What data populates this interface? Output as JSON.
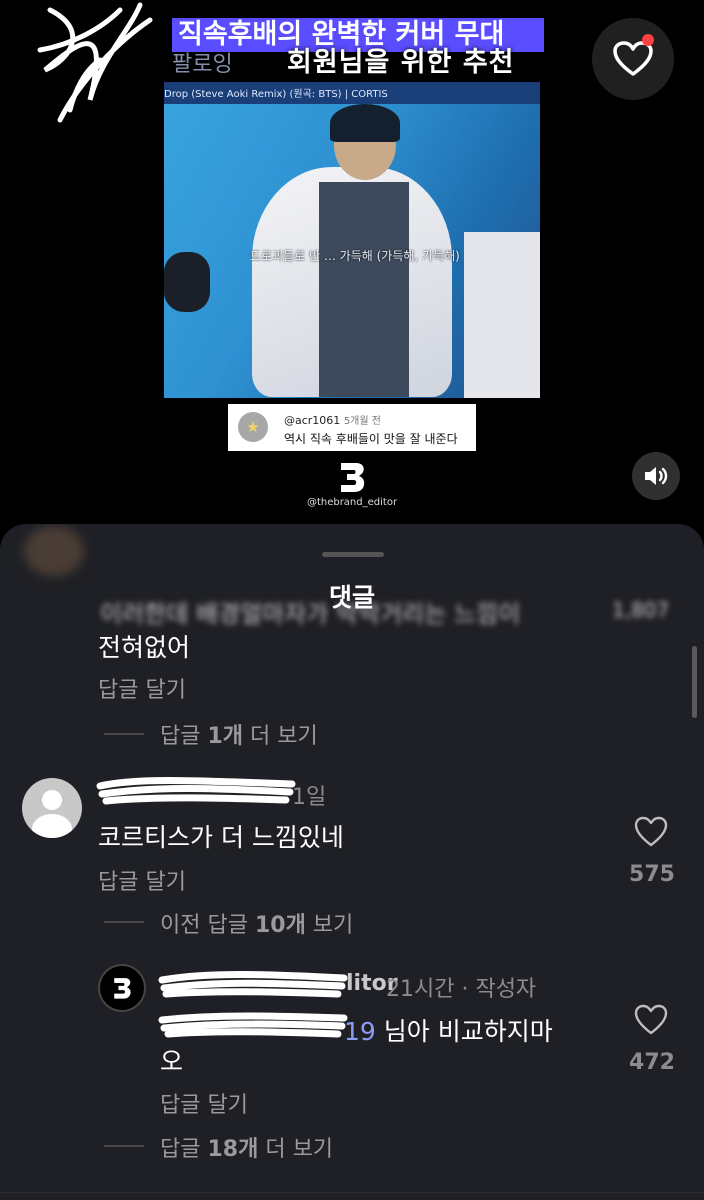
{
  "video": {
    "title_banner": "직속후배의 완벽한 커버 무대",
    "follow_label": "팔로잉",
    "recommend_label": "회원님을 위한 추천",
    "thumbnail_caption": "Drop (Steve Aoki Remix) (원곡: BTS) | CORTIS",
    "thumbnail_overlay": "드로괴들로 반 … 가득해 (가득해, 가득해)",
    "embedded_comment": {
      "user": "@acr1061",
      "time": "5개월 전",
      "text": "역시 직속 후배들이 맛을 잘 내준다"
    },
    "brand_handle": "@thebrand_editor"
  },
  "sheet": {
    "title": "댓글",
    "blurred_text": "이러한데 배경얼마자가 막막거리는 느낌이",
    "blurred_count": "1,807",
    "comment0": {
      "text": "전혀없어",
      "reply_label": "답글 달기",
      "more_prefix": "답글 ",
      "more_count": "1개",
      "more_suffix": " 더 보기"
    },
    "comment1": {
      "time": "1일",
      "text": "코르티스가 더 느낌있네",
      "reply_label": "답글 달기",
      "likes": "575",
      "more_prefix": "이전 답글 ",
      "more_count": "10개",
      "more_suffix": " 보기"
    },
    "comment2": {
      "username_tail": "litor",
      "meta": "21시간 · 작성자",
      "mention_tail": "19",
      "text_line1": "님아 비교하지마",
      "text_line2": "오",
      "reply_label": "답글 달기",
      "likes": "472",
      "more_prefix": "답글 ",
      "more_count": "18개",
      "more_suffix": " 더 보기"
    }
  },
  "colors": {
    "banner": "#5a4cff",
    "sheet_bg": "#1f2025",
    "notification_dot": "#ff4040",
    "mention": "#8e9bf4"
  },
  "icons": [
    "heart-icon",
    "sound-icon",
    "brand-b-logo",
    "default-avatar-icon",
    "like-heart-icon"
  ]
}
